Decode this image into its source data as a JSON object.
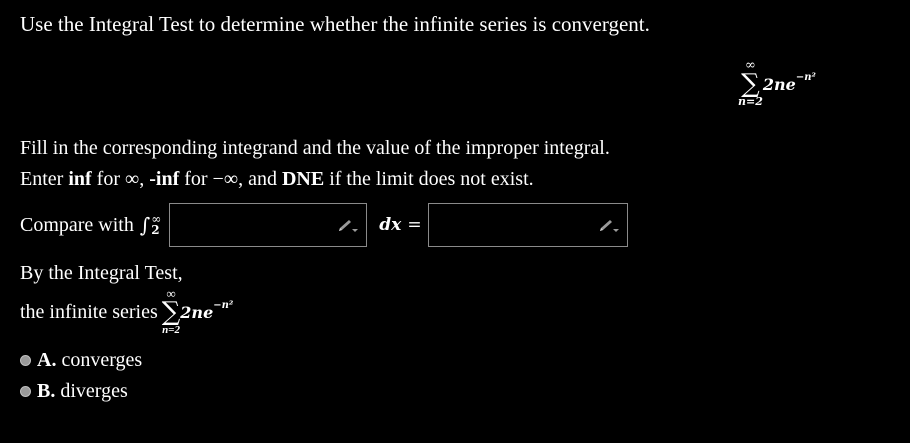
{
  "question": "Use the Integral Test to determine whether the infinite series is convergent.",
  "series": {
    "upper": "∞",
    "sigma": "∑",
    "lower": "n=2",
    "term_base": "2ne",
    "term_exp": "−n²"
  },
  "instructions": {
    "line1": "Fill in the corresponding integrand and the value of the improper integral.",
    "line2_pre": "Enter ",
    "inf": "inf",
    "for1": " for ∞, ",
    "neg_inf": "-inf",
    "for2": " for −∞, and ",
    "dne": "DNE",
    "line2_post": " if the limit does not exist."
  },
  "compare": {
    "label": "Compare with",
    "integral_sym": "∫",
    "upper": "∞",
    "lower": "2",
    "dx": "dx",
    "equals": "=",
    "integrand_value": "",
    "result_value": ""
  },
  "conclusion": {
    "by_test": "By the Integral Test,",
    "series_prefix": "the infinite series"
  },
  "options": [
    {
      "letter": "A.",
      "label": "converges"
    },
    {
      "letter": "B.",
      "label": "diverges"
    }
  ]
}
